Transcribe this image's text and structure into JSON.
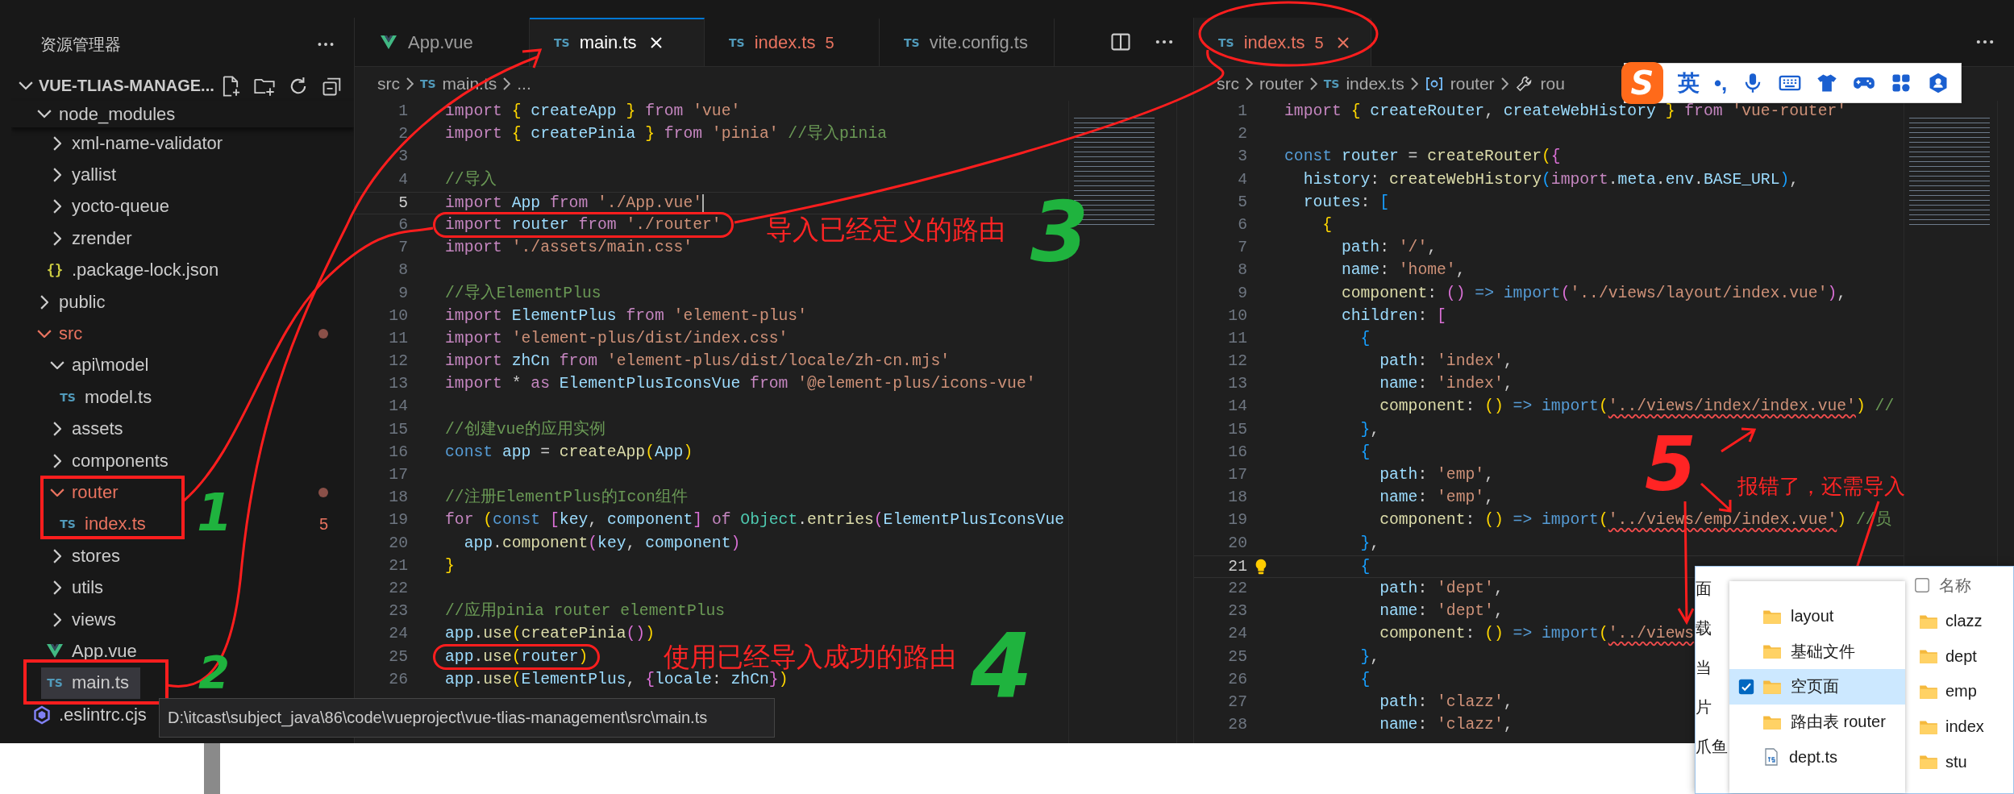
{
  "explorer": {
    "title": "资源管理器",
    "project": {
      "name": "VUE-TLIAS-MANAGE...",
      "expanded": true
    },
    "tree": [
      {
        "label": "node_modules",
        "kind": "folder",
        "expanded": true,
        "selected": false,
        "error": false,
        "children": [
          {
            "label": "xml-name-validator",
            "kind": "folder",
            "expanded": false,
            "selected": false,
            "error": false
          },
          {
            "label": "yallist",
            "kind": "folder",
            "expanded": false,
            "selected": false,
            "error": false
          },
          {
            "label": "yocto-queue",
            "kind": "folder",
            "expanded": false,
            "selected": false,
            "error": false
          },
          {
            "label": "zrender",
            "kind": "folder",
            "expanded": false,
            "selected": false,
            "error": false
          },
          {
            "label": ".package-lock.json",
            "kind": "json",
            "icon_text": "{}",
            "selected": false,
            "error": false
          }
        ]
      },
      {
        "label": "public",
        "kind": "folder",
        "expanded": false,
        "selected": false,
        "error": false
      },
      {
        "label": "src",
        "kind": "folder",
        "expanded": true,
        "selected": false,
        "error": true,
        "children": [
          {
            "label": "api\\model",
            "kind": "folder",
            "expanded": true,
            "selected": false,
            "error": false,
            "children": [
              {
                "label": "model.ts",
                "kind": "ts",
                "icon_text": "TS",
                "selected": false,
                "error": false
              }
            ]
          },
          {
            "label": "assets",
            "kind": "folder",
            "expanded": false,
            "selected": false,
            "error": false
          },
          {
            "label": "components",
            "kind": "folder",
            "expanded": false,
            "selected": false,
            "error": false
          },
          {
            "label": "router",
            "kind": "folder",
            "expanded": true,
            "selected": false,
            "error": true,
            "children": [
              {
                "label": "index.ts",
                "kind": "ts",
                "icon_text": "TS",
                "selected": false,
                "error": true,
                "problems": "5"
              }
            ]
          },
          {
            "label": "stores",
            "kind": "folder",
            "expanded": false,
            "selected": false,
            "error": false
          },
          {
            "label": "utils",
            "kind": "folder",
            "expanded": false,
            "selected": false,
            "error": false
          },
          {
            "label": "views",
            "kind": "folder",
            "expanded": false,
            "selected": false,
            "error": false
          },
          {
            "label": "App.vue",
            "kind": "vue",
            "selected": false,
            "error": false
          },
          {
            "label": "main.ts",
            "kind": "ts",
            "icon_text": "TS",
            "selected": true,
            "error": false
          }
        ]
      },
      {
        "label": ".eslintrc.cjs",
        "kind": "eslint",
        "selected": false,
        "error": false
      }
    ]
  },
  "editors": [
    {
      "focused": true,
      "quick_fix": false,
      "tabs": [
        {
          "label": "App.vue",
          "kind": "vue",
          "selected": false,
          "error": false
        },
        {
          "label": "main.ts",
          "kind": "ts",
          "icon_text": "TS",
          "selected": true,
          "error": false
        },
        {
          "label": "index.ts",
          "kind": "ts",
          "icon_text": "TS",
          "selected": false,
          "error": true,
          "problems": "5"
        },
        {
          "label": "vite.config.ts",
          "kind": "ts",
          "icon_text": "TS",
          "selected": false,
          "error": false
        }
      ],
      "breadcrumbs": [
        {
          "kind": "folder",
          "text": "src"
        },
        {
          "kind": "ts",
          "icon_text": "TS",
          "text": "main.ts"
        },
        {
          "kind": "more",
          "text": "..."
        }
      ],
      "lines": [
        {
          "number": "1",
          "current": false,
          "tokens": [
            {
              "kind": "kw",
              "text": "import "
            },
            {
              "kind": "b1",
              "text": "{"
            },
            {
              "kind": "var",
              "text": " createApp "
            },
            {
              "kind": "b1",
              "text": "}"
            },
            {
              "kind": "kw",
              "text": " from "
            },
            {
              "kind": "str",
              "text": "'vue'"
            }
          ]
        },
        {
          "number": "2",
          "current": false,
          "tokens": [
            {
              "kind": "kw",
              "text": "import "
            },
            {
              "kind": "b1",
              "text": "{"
            },
            {
              "kind": "var",
              "text": " createPinia "
            },
            {
              "kind": "b1",
              "text": "}"
            },
            {
              "kind": "kw",
              "text": " from "
            },
            {
              "kind": "str",
              "text": "'pinia'"
            },
            {
              "kind": "cm",
              "text": " //导入pinia"
            }
          ]
        },
        {
          "number": "3",
          "current": false
        },
        {
          "number": "4",
          "current": false,
          "tokens": [
            {
              "kind": "cm",
              "text": "//导入"
            }
          ]
        },
        {
          "number": "5",
          "current": true,
          "tokens": [
            {
              "kind": "kw",
              "text": "import"
            },
            {
              "kind": "var",
              "text": " App "
            },
            {
              "kind": "kw",
              "text": "from "
            },
            {
              "kind": "str",
              "text": "'./App.vue'"
            }
          ]
        },
        {
          "number": "6",
          "current": false,
          "tokens": [
            {
              "kind": "kw",
              "text": "import"
            },
            {
              "kind": "var",
              "text": " router "
            },
            {
              "kind": "kw",
              "text": "from "
            },
            {
              "kind": "str",
              "text": "'./router'"
            }
          ]
        },
        {
          "number": "7",
          "current": false,
          "tokens": [
            {
              "kind": "kw",
              "text": "import "
            },
            {
              "kind": "str",
              "text": "'./assets/main.css'"
            }
          ]
        },
        {
          "number": "8",
          "current": false
        },
        {
          "number": "9",
          "current": false,
          "tokens": [
            {
              "kind": "cm",
              "text": "//导入ElementPlus"
            }
          ]
        },
        {
          "number": "10",
          "current": false,
          "tokens": [
            {
              "kind": "kw",
              "text": "import"
            },
            {
              "kind": "var",
              "text": " ElementPlus "
            },
            {
              "kind": "kw",
              "text": "from "
            },
            {
              "kind": "str",
              "text": "'element-plus'"
            }
          ]
        },
        {
          "number": "11",
          "current": false,
          "tokens": [
            {
              "kind": "kw",
              "text": "import "
            },
            {
              "kind": "str",
              "text": "'element-plus/dist/index.css'"
            }
          ]
        },
        {
          "number": "12",
          "current": false,
          "tokens": [
            {
              "kind": "kw",
              "text": "import"
            },
            {
              "kind": "var",
              "text": " zhCn "
            },
            {
              "kind": "kw",
              "text": "from "
            },
            {
              "kind": "str",
              "text": "'element-plus/dist/locale/zh-cn.mjs'"
            }
          ]
        },
        {
          "number": "13",
          "current": false,
          "tokens": [
            {
              "kind": "kw",
              "text": "import "
            },
            {
              "kind": "p",
              "text": "* "
            },
            {
              "kind": "kw",
              "text": "as "
            },
            {
              "kind": "var",
              "text": "ElementPlusIconsVue "
            },
            {
              "kind": "kw",
              "text": "from "
            },
            {
              "kind": "str",
              "text": "'@element-plus/icons-vue'"
            }
          ]
        },
        {
          "number": "14",
          "current": false
        },
        {
          "number": "15",
          "current": false,
          "tokens": [
            {
              "kind": "cm",
              "text": "//创建vue的应用实例"
            }
          ]
        },
        {
          "number": "16",
          "current": false,
          "tokens": [
            {
              "kind": "st",
              "text": "const "
            },
            {
              "kind": "var",
              "text": "app "
            },
            {
              "kind": "p",
              "text": "= "
            },
            {
              "kind": "fn",
              "text": "createApp"
            },
            {
              "kind": "b1",
              "text": "("
            },
            {
              "kind": "var",
              "text": "App"
            },
            {
              "kind": "b1",
              "text": ")"
            }
          ]
        },
        {
          "number": "17",
          "current": false
        },
        {
          "number": "18",
          "current": false,
          "tokens": [
            {
              "kind": "cm",
              "text": "//注册ElementPlus的Icon组件"
            }
          ]
        },
        {
          "number": "19",
          "current": false,
          "tokens": [
            {
              "kind": "kw",
              "text": "for "
            },
            {
              "kind": "b1",
              "text": "("
            },
            {
              "kind": "st",
              "text": "const "
            },
            {
              "kind": "b2",
              "text": "["
            },
            {
              "kind": "var",
              "text": "key"
            },
            {
              "kind": "p",
              "text": ", "
            },
            {
              "kind": "var",
              "text": "component"
            },
            {
              "kind": "b2",
              "text": "]"
            },
            {
              "kind": "kw",
              "text": " of "
            },
            {
              "kind": "cls",
              "text": "Object"
            },
            {
              "kind": "p",
              "text": "."
            },
            {
              "kind": "fn",
              "text": "entries"
            },
            {
              "kind": "b2",
              "text": "("
            },
            {
              "kind": "var",
              "text": "ElementPlusIconsVue"
            }
          ]
        },
        {
          "number": "20",
          "current": false,
          "tokens": [
            {
              "kind": "var",
              "text": "  app"
            },
            {
              "kind": "p",
              "text": "."
            },
            {
              "kind": "fn",
              "text": "component"
            },
            {
              "kind": "b2",
              "text": "("
            },
            {
              "kind": "var",
              "text": "key"
            },
            {
              "kind": "p",
              "text": ", "
            },
            {
              "kind": "var",
              "text": "component"
            },
            {
              "kind": "b2",
              "text": ")"
            }
          ]
        },
        {
          "number": "21",
          "current": false,
          "tokens": [
            {
              "kind": "b1",
              "text": "}"
            }
          ]
        },
        {
          "number": "22",
          "current": false
        },
        {
          "number": "23",
          "current": false,
          "tokens": [
            {
              "kind": "cm",
              "text": "//应用pinia router elementPlus"
            }
          ]
        },
        {
          "number": "24",
          "current": false,
          "tokens": [
            {
              "kind": "var",
              "text": "app"
            },
            {
              "kind": "p",
              "text": "."
            },
            {
              "kind": "fn",
              "text": "use"
            },
            {
              "kind": "b1",
              "text": "("
            },
            {
              "kind": "fn",
              "text": "createPinia"
            },
            {
              "kind": "b2",
              "text": "()"
            },
            {
              "kind": "b1",
              "text": ")"
            }
          ]
        },
        {
          "number": "25",
          "current": false,
          "tokens": [
            {
              "kind": "var",
              "text": "app"
            },
            {
              "kind": "p",
              "text": "."
            },
            {
              "kind": "fn",
              "text": "use"
            },
            {
              "kind": "b1",
              "text": "("
            },
            {
              "kind": "var",
              "text": "router"
            },
            {
              "kind": "b1",
              "text": ")"
            }
          ]
        },
        {
          "number": "26",
          "current": false,
          "tokens": [
            {
              "kind": "var",
              "text": "app"
            },
            {
              "kind": "p",
              "text": "."
            },
            {
              "kind": "fn",
              "text": "use"
            },
            {
              "kind": "b1",
              "text": "("
            },
            {
              "kind": "var",
              "text": "ElementPlus"
            },
            {
              "kind": "p",
              "text": ", "
            },
            {
              "kind": "b2",
              "text": "{"
            },
            {
              "kind": "var",
              "text": "locale"
            },
            {
              "kind": "p",
              "text": ": "
            },
            {
              "kind": "var",
              "text": "zhCn"
            },
            {
              "kind": "b2",
              "text": "}"
            },
            {
              "kind": "b1",
              "text": ")"
            }
          ]
        }
      ]
    },
    {
      "focused": false,
      "quick_fix": true,
      "tabs": [
        {
          "label": "index.ts",
          "kind": "ts",
          "icon_text": "TS",
          "selected": true,
          "error": true,
          "problems": "5"
        }
      ],
      "breadcrumbs": [
        {
          "kind": "folder",
          "text": "src"
        },
        {
          "kind": "folder",
          "text": "router"
        },
        {
          "kind": "ts",
          "icon_text": "TS",
          "text": "index.ts"
        },
        {
          "kind": "variable",
          "text": "router"
        },
        {
          "kind": "property",
          "text": "rou"
        }
      ],
      "lines": [
        {
          "number": "1",
          "current": false,
          "tokens": [
            {
              "kind": "kw",
              "text": "import "
            },
            {
              "kind": "b1",
              "text": "{"
            },
            {
              "kind": "var",
              "text": " createRouter"
            },
            {
              "kind": "p",
              "text": ", "
            },
            {
              "kind": "var",
              "text": "createWebHistory "
            },
            {
              "kind": "b1",
              "text": "}"
            },
            {
              "kind": "kw",
              "text": " from "
            },
            {
              "kind": "str",
              "text": "'vue-router'"
            }
          ]
        },
        {
          "number": "2",
          "current": false
        },
        {
          "number": "3",
          "current": false,
          "tokens": [
            {
              "kind": "st",
              "text": "const "
            },
            {
              "kind": "var",
              "text": "router "
            },
            {
              "kind": "p",
              "text": "= "
            },
            {
              "kind": "fn",
              "text": "createRouter"
            },
            {
              "kind": "b1",
              "text": "("
            },
            {
              "kind": "b2",
              "text": "{"
            }
          ]
        },
        {
          "number": "4",
          "current": false,
          "tokens": [
            {
              "kind": "var",
              "text": "  history"
            },
            {
              "kind": "p",
              "text": ": "
            },
            {
              "kind": "fn",
              "text": "createWebHistory"
            },
            {
              "kind": "b3",
              "text": "("
            },
            {
              "kind": "kw",
              "text": "import"
            },
            {
              "kind": "p",
              "text": "."
            },
            {
              "kind": "var",
              "text": "meta"
            },
            {
              "kind": "p",
              "text": "."
            },
            {
              "kind": "var",
              "text": "env"
            },
            {
              "kind": "p",
              "text": "."
            },
            {
              "kind": "var",
              "text": "BASE_URL"
            },
            {
              "kind": "b3",
              "text": ")"
            },
            {
              "kind": "p",
              "text": ","
            }
          ]
        },
        {
          "number": "5",
          "current": false,
          "tokens": [
            {
              "kind": "var",
              "text": "  routes"
            },
            {
              "kind": "p",
              "text": ": "
            },
            {
              "kind": "b3",
              "text": "["
            }
          ]
        },
        {
          "number": "6",
          "current": false,
          "tokens": [
            {
              "kind": "b1",
              "text": "    {"
            }
          ]
        },
        {
          "number": "7",
          "current": false,
          "tokens": [
            {
              "kind": "var",
              "text": "      path"
            },
            {
              "kind": "p",
              "text": ": "
            },
            {
              "kind": "str",
              "text": "'/'"
            },
            {
              "kind": "p",
              "text": ","
            }
          ]
        },
        {
          "number": "8",
          "current": false,
          "tokens": [
            {
              "kind": "var",
              "text": "      name"
            },
            {
              "kind": "p",
              "text": ": "
            },
            {
              "kind": "str",
              "text": "'home'"
            },
            {
              "kind": "p",
              "text": ","
            }
          ]
        },
        {
          "number": "9",
          "current": false,
          "tokens": [
            {
              "kind": "fn",
              "text": "      component"
            },
            {
              "kind": "p",
              "text": ": "
            },
            {
              "kind": "b2",
              "text": "()"
            },
            {
              "kind": "st",
              "text": " => import"
            },
            {
              "kind": "b2",
              "text": "("
            },
            {
              "kind": "str",
              "text": "'../views/layout/index.vue'"
            },
            {
              "kind": "b2",
              "text": ")"
            },
            {
              "kind": "p",
              "text": ","
            }
          ]
        },
        {
          "number": "10",
          "current": false,
          "tokens": [
            {
              "kind": "var",
              "text": "      children"
            },
            {
              "kind": "p",
              "text": ": "
            },
            {
              "kind": "b2",
              "text": "["
            }
          ]
        },
        {
          "number": "11",
          "current": false,
          "tokens": [
            {
              "kind": "b3",
              "text": "        {"
            }
          ]
        },
        {
          "number": "12",
          "current": false,
          "tokens": [
            {
              "kind": "var",
              "text": "          path"
            },
            {
              "kind": "p",
              "text": ": "
            },
            {
              "kind": "str",
              "text": "'index'"
            },
            {
              "kind": "p",
              "text": ","
            }
          ]
        },
        {
          "number": "13",
          "current": false,
          "tokens": [
            {
              "kind": "var",
              "text": "          name"
            },
            {
              "kind": "p",
              "text": ": "
            },
            {
              "kind": "str",
              "text": "'index'"
            },
            {
              "kind": "p",
              "text": ","
            }
          ]
        },
        {
          "number": "14",
          "current": false,
          "tokens": [
            {
              "kind": "fn",
              "text": "          component"
            },
            {
              "kind": "p",
              "text": ": "
            },
            {
              "kind": "b1",
              "text": "()"
            },
            {
              "kind": "st",
              "text": " => import"
            },
            {
              "kind": "b1",
              "text": "("
            },
            {
              "kind": "err",
              "text": "'../views/index/index.vue'"
            },
            {
              "kind": "b1",
              "text": ")"
            },
            {
              "kind": "cm",
              "text": " //"
            }
          ]
        },
        {
          "number": "15",
          "current": false,
          "tokens": [
            {
              "kind": "b3",
              "text": "        }"
            },
            {
              "kind": "p",
              "text": ","
            }
          ]
        },
        {
          "number": "16",
          "current": false,
          "tokens": [
            {
              "kind": "b3",
              "text": "        {"
            }
          ]
        },
        {
          "number": "17",
          "current": false,
          "tokens": [
            {
              "kind": "var",
              "text": "          path"
            },
            {
              "kind": "p",
              "text": ": "
            },
            {
              "kind": "str",
              "text": "'emp'"
            },
            {
              "kind": "p",
              "text": ","
            }
          ]
        },
        {
          "number": "18",
          "current": false,
          "tokens": [
            {
              "kind": "var",
              "text": "          name"
            },
            {
              "kind": "p",
              "text": ": "
            },
            {
              "kind": "str",
              "text": "'emp'"
            },
            {
              "kind": "p",
              "text": ","
            }
          ]
        },
        {
          "number": "19",
          "current": false,
          "tokens": [
            {
              "kind": "fn",
              "text": "          component"
            },
            {
              "kind": "p",
              "text": ": "
            },
            {
              "kind": "b1",
              "text": "()"
            },
            {
              "kind": "st",
              "text": " => import"
            },
            {
              "kind": "b1",
              "text": "("
            },
            {
              "kind": "err",
              "text": "'../views/emp/index.vue'"
            },
            {
              "kind": "b1",
              "text": ")"
            },
            {
              "kind": "cm",
              "text": " //员"
            }
          ]
        },
        {
          "number": "20",
          "current": false,
          "tokens": [
            {
              "kind": "b3",
              "text": "        }"
            },
            {
              "kind": "p",
              "text": ","
            }
          ]
        },
        {
          "number": "21",
          "current": true,
          "tokens": [
            {
              "kind": "b3",
              "text": "        {"
            }
          ]
        },
        {
          "number": "22",
          "current": false,
          "tokens": [
            {
              "kind": "var",
              "text": "          path"
            },
            {
              "kind": "p",
              "text": ": "
            },
            {
              "kind": "str",
              "text": "'dept'"
            },
            {
              "kind": "p",
              "text": ","
            }
          ]
        },
        {
          "number": "23",
          "current": false,
          "tokens": [
            {
              "kind": "var",
              "text": "          name"
            },
            {
              "kind": "p",
              "text": ": "
            },
            {
              "kind": "str",
              "text": "'dept'"
            },
            {
              "kind": "p",
              "text": ","
            }
          ]
        },
        {
          "number": "24",
          "current": false,
          "tokens": [
            {
              "kind": "fn",
              "text": "          component"
            },
            {
              "kind": "p",
              "text": ": "
            },
            {
              "kind": "b1",
              "text": "()"
            },
            {
              "kind": "st",
              "text": " => import"
            },
            {
              "kind": "b1",
              "text": "("
            },
            {
              "kind": "err",
              "text": "'../views"
            }
          ]
        },
        {
          "number": "25",
          "current": false,
          "tokens": [
            {
              "kind": "b3",
              "text": "        }"
            },
            {
              "kind": "p",
              "text": ","
            }
          ]
        },
        {
          "number": "26",
          "current": false,
          "tokens": [
            {
              "kind": "b3",
              "text": "        {"
            }
          ]
        },
        {
          "number": "27",
          "current": false,
          "tokens": [
            {
              "kind": "var",
              "text": "          path"
            },
            {
              "kind": "p",
              "text": ": "
            },
            {
              "kind": "str",
              "text": "'clazz'"
            },
            {
              "kind": "p",
              "text": ","
            }
          ]
        },
        {
          "number": "28",
          "current": false,
          "tokens": [
            {
              "kind": "var",
              "text": "          name"
            },
            {
              "kind": "p",
              "text": ": "
            },
            {
              "kind": "str",
              "text": "'clazz'"
            },
            {
              "kind": "p",
              "text": ","
            }
          ]
        }
      ]
    }
  ],
  "tooltip": {
    "text": "D:\\itcast\\subject_java\\86\\code\\vueproject\\vue-tlias-management\\src\\main.ts"
  },
  "ime_toolbar": {
    "logo": "S",
    "language": "英",
    "punctuation": "•,"
  },
  "file_dialog": {
    "side_labels": [
      "面",
      "载",
      "当",
      "片",
      "爪鱼"
    ],
    "dropdown": [
      {
        "kind": "folder",
        "label": "layout",
        "selected": false
      },
      {
        "kind": "folder",
        "label": "基础文件",
        "selected": false
      },
      {
        "kind": "folder",
        "label": "空页面",
        "selected": true
      },
      {
        "kind": "folder",
        "label": "路由表 router",
        "selected": false
      },
      {
        "kind": "ts",
        "label": "dept.ts",
        "selected": false
      }
    ],
    "column_header": "名称",
    "files": [
      {
        "label": "clazz"
      },
      {
        "label": "dept"
      },
      {
        "label": "emp"
      },
      {
        "label": "index"
      },
      {
        "label": "stu"
      }
    ]
  },
  "annotations": [
    {
      "kind": "note",
      "text": "导入已经定义的路由",
      "color": "#ff2424"
    },
    {
      "kind": "step",
      "text": "3",
      "color": "#1fb33e"
    },
    {
      "kind": "note",
      "text": "使用已经导入成功的路由",
      "color": "#ff2424"
    },
    {
      "kind": "step",
      "text": "4",
      "color": "#1fb33e"
    },
    {
      "kind": "step",
      "text": "1",
      "color": "#1fb33e"
    },
    {
      "kind": "step",
      "text": "2",
      "color": "#1fb33e"
    },
    {
      "kind": "step",
      "text": "5",
      "color": "#ff2424"
    },
    {
      "kind": "note",
      "text": "报错了，还需导入",
      "color": "#ff2424"
    }
  ]
}
